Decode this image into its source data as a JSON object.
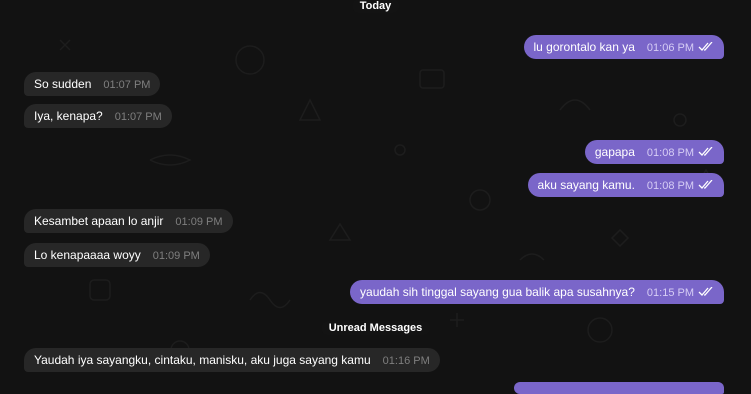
{
  "date_separator": "Today",
  "unread_separator": "Unread Messages",
  "messages": [
    {
      "direction": "outgoing",
      "text": "lu gorontalo kan ya",
      "time": "01:06 PM",
      "status": "read"
    },
    {
      "direction": "incoming",
      "text": "So sudden",
      "time": "01:07 PM"
    },
    {
      "direction": "incoming",
      "text": "Iya, kenapa?",
      "time": "01:07 PM"
    },
    {
      "direction": "outgoing",
      "text": "gapapa",
      "time": "01:08 PM",
      "status": "read"
    },
    {
      "direction": "outgoing",
      "text": "aku sayang kamu.",
      "time": "01:08 PM",
      "status": "read"
    },
    {
      "direction": "incoming",
      "text": "Kesambet apaan lo anjir",
      "time": "01:09 PM"
    },
    {
      "direction": "incoming",
      "text": "Lo kenapaaaa woyy",
      "time": "01:09 PM"
    },
    {
      "direction": "outgoing",
      "text": "yaudah sih tinggal sayang gua balik apa susahnya?",
      "time": "01:15 PM",
      "status": "read"
    },
    {
      "direction": "incoming",
      "text": "Yaudah iya sayangku, cintaku, manisku, aku juga sayang kamu",
      "time": "01:16 PM"
    }
  ],
  "colors": {
    "background": "#121212",
    "incoming_bubble": "#272727",
    "outgoing_bubble": "#7a66c9"
  },
  "icons": {
    "read_receipt": "double-check-icon",
    "wallpaper": "doodle-pattern"
  }
}
